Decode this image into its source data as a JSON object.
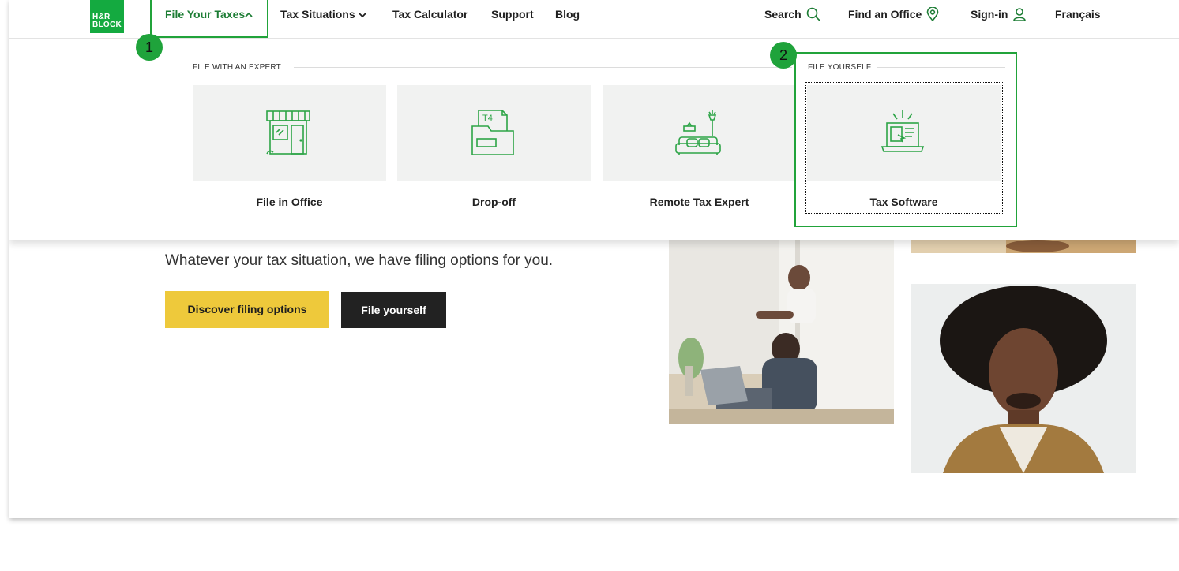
{
  "nav": {
    "logo_text": "H&R BLOCK",
    "file_your_taxes": "File Your Taxes",
    "tax_situations": "Tax Situations",
    "tax_calculator": "Tax Calculator",
    "support": "Support",
    "blog": "Blog",
    "search": "Search",
    "find_office": "Find an Office",
    "sign_in": "Sign-in",
    "language": "Français",
    "active_color": "#1d7d35",
    "brand_color": "#14aa40"
  },
  "markers": {
    "one": "1",
    "two": "2"
  },
  "menu": {
    "expert_heading": "FILE WITH AN EXPERT",
    "yourself_heading": "FILE YOURSELF",
    "cards": [
      {
        "label": "File in Office",
        "icon": "storefront-icon"
      },
      {
        "label": "Drop-off",
        "icon": "t4-folder-icon"
      },
      {
        "label": "Remote Tax Expert",
        "icon": "couch-lamp-icon"
      },
      {
        "label": "Tax Software",
        "icon": "laptop-software-icon"
      }
    ],
    "t4_text": "T4"
  },
  "hero": {
    "tagline": "Whatever your tax situation, we have filing options for you.",
    "primary_button": "Discover filing options",
    "secondary_button": "File yourself",
    "primary_color": "#eec93b",
    "secondary_color": "#222222"
  }
}
